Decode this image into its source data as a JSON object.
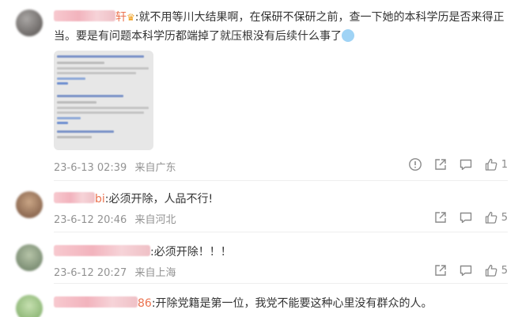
{
  "comments": [
    {
      "name_tail": "轩",
      "text": ":就不用等川大结果啊，在保研不保研之前，查一下她的本科学历是否来得正当。要是有问题本科学历都端掉了就压根没有后续什么事了",
      "time": "23-6-13 02:39",
      "location": "来自广东",
      "likes": "1",
      "avatar_color": "#7d7a78"
    },
    {
      "name_tail": "bi",
      "text": ":必须开除，人品不行!",
      "time": "23-6-12 20:46",
      "location": "来自河北",
      "likes": "5",
      "avatar_color": "#b08a6a"
    },
    {
      "name_tail": "",
      "text": ":必须开除！！！",
      "time": "23-6-12 20:27",
      "location": "来自上海",
      "likes": "5",
      "avatar_color": "#8fa08a"
    },
    {
      "name_tail": "86",
      "text": ":开除党籍是第一位，我党不能要这种心里没有群众的人。",
      "time": "",
      "location": "",
      "likes": "",
      "avatar_color": "#9ec48a"
    }
  ],
  "icons": {
    "report": "report-icon",
    "share": "share-icon",
    "reply": "comment-icon",
    "like": "thumbs-up-icon"
  },
  "colors": {
    "meta_text": "#939393",
    "name_accent": "#eb7350"
  }
}
